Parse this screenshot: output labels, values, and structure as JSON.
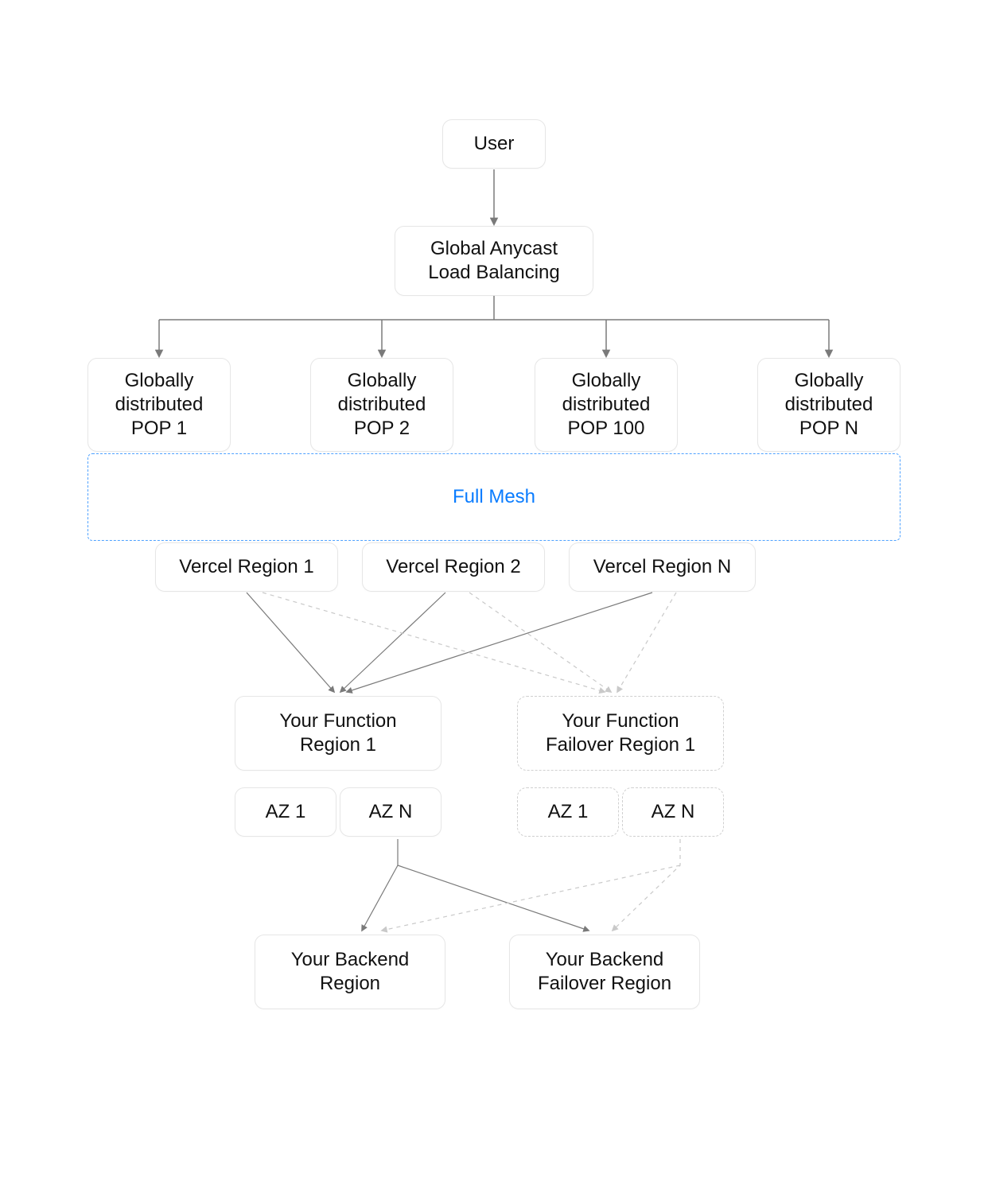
{
  "diagram": {
    "user": "User",
    "anycast": "Global Anycast\nLoad Balancing",
    "pops": [
      "Globally\ndistributed\nPOP 1",
      "Globally\ndistributed\nPOP 2",
      "Globally\ndistributed\nPOP 100",
      "Globally\ndistributed\nPOP N"
    ],
    "mesh": "Full Mesh",
    "regions": [
      "Vercel Region 1",
      "Vercel Region 2",
      "Vercel Region N"
    ],
    "function_primary": "Your Function\nRegion 1",
    "function_failover": "Your Function\nFailover Region 1",
    "az_primary": [
      "AZ 1",
      "AZ N"
    ],
    "az_failover": [
      "AZ 1",
      "AZ N"
    ],
    "backend_primary": "Your Backend\nRegion",
    "backend_failover": "Your Backend\nFailover Region"
  },
  "colors": {
    "line": "#7a7a7a",
    "line_light": "#c9c9c9",
    "mesh_border": "#4ea1ff",
    "mesh_text": "#0a7cff",
    "box_border": "#e6e6e6"
  }
}
